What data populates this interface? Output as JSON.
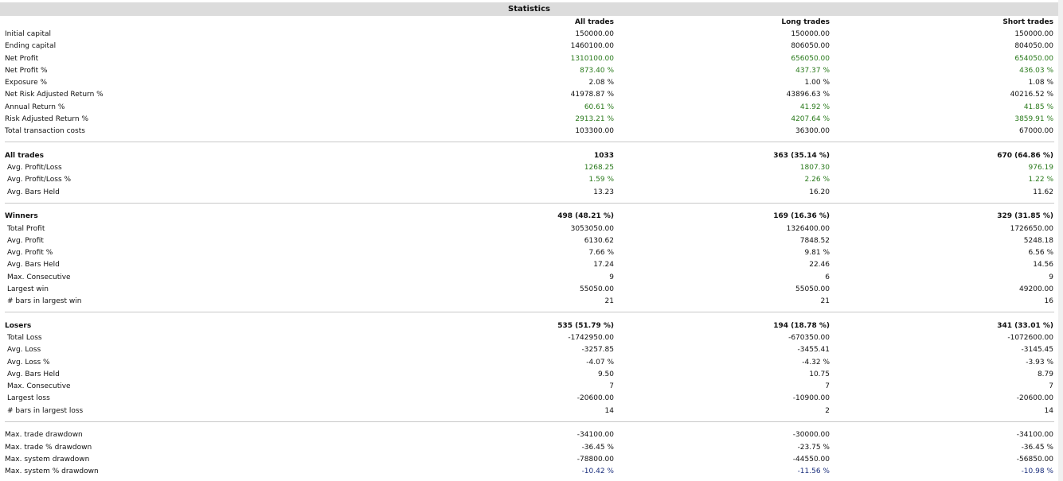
{
  "title": "Statistics",
  "columns": [
    "All trades",
    "Long trades",
    "Short trades"
  ],
  "colors": {
    "positive": "#2a7a1c",
    "negative_pct": "#1a2e7c",
    "header_bg": "#dcdcdc"
  },
  "sections": [
    {
      "rows": [
        {
          "label": "Initial capital",
          "values": [
            "150000.00",
            "150000.00",
            "150000.00"
          ]
        },
        {
          "label": "Ending capital",
          "values": [
            "1460100.00",
            "806050.00",
            "804050.00"
          ]
        },
        {
          "label": "Net Profit",
          "values": [
            "1310100.00",
            "656050.00",
            "654050.00"
          ],
          "color": "green"
        },
        {
          "label": "Net Profit %",
          "values": [
            "873.40 %",
            "437.37 %",
            "436.03 %"
          ],
          "color": "green"
        },
        {
          "label": "Exposure %",
          "values": [
            "2.08 %",
            "1.00 %",
            "1.08 %"
          ]
        },
        {
          "label": "Net Risk Adjusted Return %",
          "values": [
            "41978.87 %",
            "43896.63 %",
            "40216.52 %"
          ]
        },
        {
          "label": "Annual Return %",
          "values": [
            "60.61 %",
            "41.92 %",
            "41.85 %"
          ],
          "color": "green"
        },
        {
          "label": "Risk Adjusted Return %",
          "values": [
            "2913.21 %",
            "4207.64 %",
            "3859.91 %"
          ],
          "color": "green"
        },
        {
          "label": "Total transaction costs",
          "values": [
            "103300.00",
            "36300.00",
            "67000.00"
          ]
        }
      ]
    },
    {
      "rows": [
        {
          "label": "All trades",
          "values": [
            "1033",
            "363 (35.14 %)",
            "670 (64.86 %)"
          ],
          "header": true
        },
        {
          "label": "Avg. Profit/Loss",
          "values": [
            "1268.25",
            "1807.30",
            "976.19"
          ],
          "color": "green",
          "sub": true
        },
        {
          "label": "Avg. Profit/Loss %",
          "values": [
            "1.59 %",
            "2.26 %",
            "1.22 %"
          ],
          "color": "green",
          "sub": true
        },
        {
          "label": "Avg. Bars Held",
          "values": [
            "13.23",
            "16.20",
            "11.62"
          ],
          "sub": true
        }
      ]
    },
    {
      "rows": [
        {
          "label": "Winners",
          "values": [
            "498 (48.21 %)",
            "169 (16.36 %)",
            "329 (31.85 %)"
          ],
          "header": true
        },
        {
          "label": "Total Profit",
          "values": [
            "3053050.00",
            "1326400.00",
            "1726650.00"
          ],
          "sub": true
        },
        {
          "label": "Avg. Profit",
          "values": [
            "6130.62",
            "7848.52",
            "5248.18"
          ],
          "sub": true
        },
        {
          "label": "Avg. Profit %",
          "values": [
            "7.66 %",
            "9.81 %",
            "6.56 %"
          ],
          "sub": true
        },
        {
          "label": "Avg. Bars Held",
          "values": [
            "17.24",
            "22.46",
            "14.56"
          ],
          "sub": true
        },
        {
          "label": "Max. Consecutive",
          "values": [
            "9",
            "6",
            "9"
          ],
          "sub": true
        },
        {
          "label": "Largest win",
          "values": [
            "55050.00",
            "55050.00",
            "49200.00"
          ],
          "sub": true
        },
        {
          "label": "# bars in largest win",
          "values": [
            "21",
            "21",
            "16"
          ],
          "sub": true
        }
      ]
    },
    {
      "rows": [
        {
          "label": "Losers",
          "values": [
            "535 (51.79 %)",
            "194 (18.78 %)",
            "341 (33.01 %)"
          ],
          "header": true
        },
        {
          "label": "Total Loss",
          "values": [
            "-1742950.00",
            "-670350.00",
            "-1072600.00"
          ],
          "sub": true
        },
        {
          "label": "Avg. Loss",
          "values": [
            "-3257.85",
            "-3455.41",
            "-3145.45"
          ],
          "sub": true
        },
        {
          "label": "Avg. Loss %",
          "values": [
            "-4.07 %",
            "-4.32 %",
            "-3.93 %"
          ],
          "sub": true
        },
        {
          "label": "Avg. Bars Held",
          "values": [
            "9.50",
            "10.75",
            "8.79"
          ],
          "sub": true
        },
        {
          "label": "Max. Consecutive",
          "values": [
            "7",
            "7",
            "7"
          ],
          "sub": true
        },
        {
          "label": "Largest loss",
          "values": [
            "-20600.00",
            "-10900.00",
            "-20600.00"
          ],
          "sub": true
        },
        {
          "label": "# bars in largest loss",
          "values": [
            "14",
            "2",
            "14"
          ],
          "sub": true
        }
      ]
    },
    {
      "rows": [
        {
          "label": "Max. trade drawdown",
          "values": [
            "-34100.00",
            "-30000.00",
            "-34100.00"
          ]
        },
        {
          "label": "Max. trade % drawdown",
          "values": [
            "-36.45 %",
            "-23.75 %",
            "-36.45 %"
          ]
        },
        {
          "label": "Max. system drawdown",
          "values": [
            "-78800.00",
            "-44550.00",
            "-56850.00"
          ]
        },
        {
          "label": "Max. system % drawdown",
          "values": [
            "-10.42 %",
            "-11.56 %",
            "-10.98 %"
          ],
          "color": "navy"
        }
      ]
    }
  ]
}
